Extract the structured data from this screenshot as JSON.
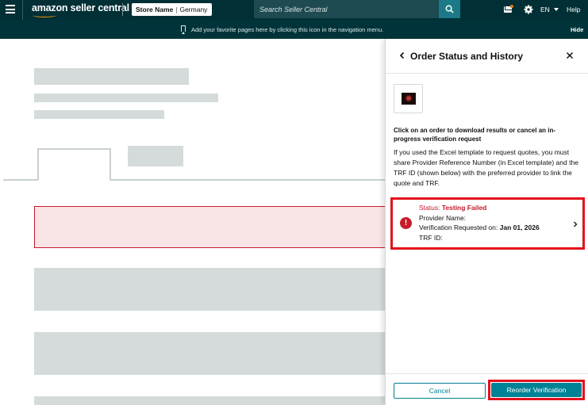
{
  "header": {
    "logo_text": "amazon seller central",
    "store_name": "Store Name",
    "store_region": "Germany",
    "search_placeholder": "Search Seller Central",
    "language": "EN",
    "help_label": "Help"
  },
  "favorites_bar": {
    "message": "Add your favorite pages here by clicking this icon in the navigation menu.",
    "hide_label": "Hide"
  },
  "panel": {
    "title": "Order Status and History",
    "instruction_bold": "Click on an order to download results or cancel an in-progress verification request",
    "instruction_text": "If you used the Excel template to request quotes, you must share Provider Reference Number (in Excel template) and the TRF ID (shown below) with the preferred provider to link the quote and TRF.",
    "order": {
      "status_label": "Status:",
      "status_value": "Testing Failed",
      "provider_label": "Provider Name:",
      "requested_label": "Verification Requested on:",
      "requested_value": "Jan 01, 2026",
      "trf_label": "TRF ID:"
    },
    "cancel_label": "Cancel",
    "reorder_label": "Reorder Verification"
  },
  "colors": {
    "header_bg": "#002f36",
    "accent_teal": "#008296",
    "error_red": "#c61b2a",
    "highlight_red": "#e3101d"
  }
}
